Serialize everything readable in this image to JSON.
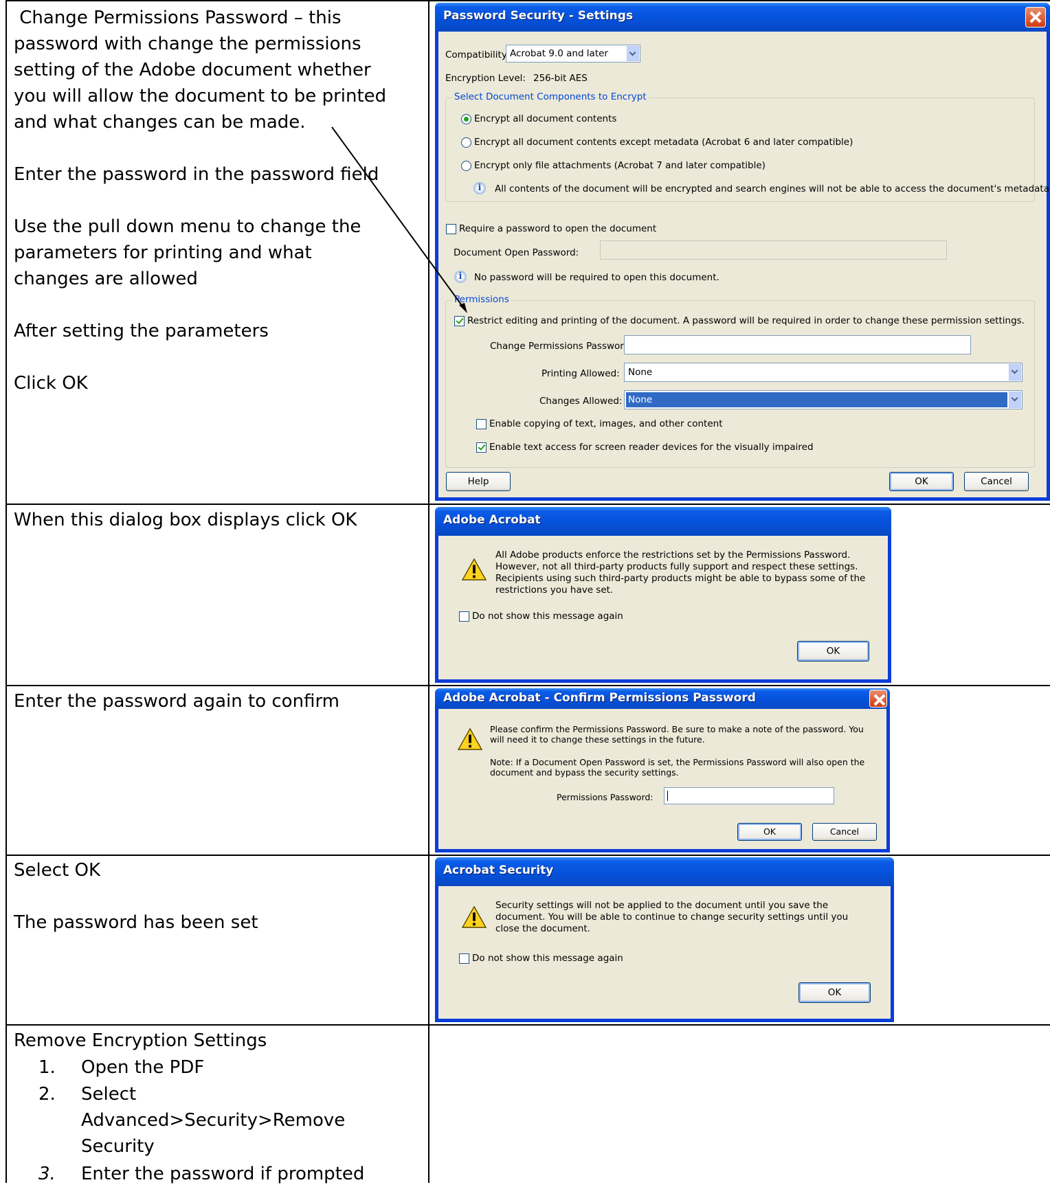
{
  "rows": [
    {
      "instructions": " Change Permissions Password – this\npassword with change the permissions\nsetting of the Adobe document whether\nyou will allow the document to be printed\nand what changes can be made.\n\nEnter the password in the password field\n\nUse the pull down menu to change the\nparameters for printing and what\nchanges are allowed\n\nAfter setting the parameters\n\nClick OK"
    },
    {
      "instructions": "When this dialog box displays click OK"
    },
    {
      "instructions": "Enter the password again to confirm"
    },
    {
      "instructions": "Select OK\n\nThe password has been set"
    }
  ],
  "remove_section": {
    "heading": "Remove Encryption Settings",
    "steps": [
      {
        "num": "1.",
        "text": "Open the PDF"
      },
      {
        "num": "2.",
        "text": "Select\nAdvanced>Security>Remove\nSecurity"
      },
      {
        "num": "3.",
        "text": "Enter the password if prompted"
      }
    ]
  },
  "security_dialog": {
    "title": "Password Security - Settings",
    "compatibility_label": "Compatibility:",
    "compatibility_value": "Acrobat 9.0 and later",
    "encryption_label": "Encryption  Level:",
    "encryption_value": "256-bit AES",
    "components_group": "Select Document Components to Encrypt",
    "options": [
      "Encrypt all document contents",
      "Encrypt all document contents except metadata (Acrobat 6 and later compatible)",
      "Encrypt only file attachments (Acrobat 7 and later compatible)"
    ],
    "components_info": "All contents of the document will be encrypted and search engines will not be able to access the document's metadata.",
    "require_open_label": "Require a password to open the document",
    "open_password_label": "Document Open Password:",
    "open_info": "No password will be required to open this document.",
    "permissions_group": "Permissions",
    "restrict_label": "Restrict editing and printing of the document. A password will be required in order to change these permission settings.",
    "change_pw_label": "Change Permissions Password:",
    "printing_label": "Printing Allowed:",
    "printing_value": "None",
    "changes_label": "Changes Allowed:",
    "changes_value": "None",
    "copy_label": "Enable copying of text, images, and other content",
    "screen_reader_label": "Enable text access for screen reader devices for the visually impaired",
    "help_button": "Help",
    "ok_button": "OK",
    "cancel_button": "Cancel"
  },
  "warning_dialog": {
    "title": "Adobe Acrobat",
    "message": "All Adobe products enforce the restrictions set by the Permissions Password.\nHowever, not all third-party products fully support and respect these settings.\nRecipients using such third-party products might be able to bypass some of the\nrestrictions you have set.",
    "checkbox_label": "Do not show this message again",
    "ok_button": "OK"
  },
  "confirm_dialog": {
    "title": "Adobe Acrobat - Confirm Permissions Password",
    "message1": "Please confirm the Permissions Password. Be sure to make a note of the password. You\nwill need it to change these settings in the future.",
    "message2": "Note: If a Document Open Password is set, the Permissions Password will also open the\ndocument and bypass the security settings.",
    "password_label": "Permissions Password:",
    "ok_button": "OK",
    "cancel_button": "Cancel"
  },
  "acrobat_security_dialog": {
    "title": "Acrobat Security",
    "message": "Security settings will not be applied to the document until you save the\ndocument. You will be able to continue to change security settings until you\nclose the document.",
    "checkbox_label": "Do not show this message again",
    "ok_button": "OK"
  }
}
